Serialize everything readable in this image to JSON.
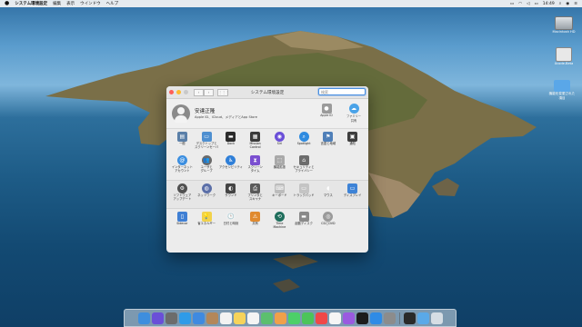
{
  "menubar": {
    "apple_icon": "apple-icon",
    "app_name": "システム環境設定",
    "menus": [
      "編集",
      "表示",
      "ウインドウ",
      "ヘルプ"
    ],
    "clock": "14:49",
    "status_icons": [
      "airplay-icon",
      "wifi-icon",
      "volume-icon",
      "battery-icon",
      "siri-icon",
      "search-icon",
      "menu-icon"
    ]
  },
  "desktop_icons": [
    {
      "label": "Macintosh HD",
      "icon": "hard-drive-icon"
    },
    {
      "label": "Xcode-Beta",
      "icon": "disk-image-icon"
    },
    {
      "label": "機能を変更された項目",
      "icon": "folder-icon"
    }
  ],
  "window": {
    "title": "システム環境設定",
    "search_placeholder": "検索",
    "nav_back": "‹",
    "nav_forward": "›",
    "grid_button": "⋮⋮⋮",
    "account": {
      "name": "安達正隆",
      "subtitle": "Apple ID、iCloud、メディアとApp Store",
      "items": [
        {
          "label": "Apple ID",
          "icon": "apple-id-icon",
          "color": "#9a9a9a"
        },
        {
          "label": "ファミリー\n共有",
          "icon": "family-sharing-icon",
          "color": "#4aa3e8"
        }
      ]
    },
    "sections": [
      [
        {
          "label": "一般",
          "icon": "general-icon",
          "color": "#5a7fa8",
          "glyph": "▤"
        },
        {
          "label": "デスクトップと\nスクリーンセーバ",
          "icon": "desktop-icon",
          "color": "#4e8fd0",
          "glyph": "▭"
        },
        {
          "label": "Dock",
          "icon": "dock-icon",
          "color": "#2b2b2b",
          "glyph": "▬"
        },
        {
          "label": "Mission\nControl",
          "icon": "mission-control-icon",
          "color": "#3a3a3a",
          "glyph": "▦"
        },
        {
          "label": "Siri",
          "icon": "siri-icon",
          "color": "#6a4fd8",
          "glyph": "◉",
          "round": true
        },
        {
          "label": "Spotlight",
          "icon": "spotlight-icon",
          "color": "#2f8be0",
          "glyph": "⌕",
          "round": true
        },
        {
          "label": "言語と地域",
          "icon": "language-icon",
          "color": "#4f7fb8",
          "glyph": "⚑"
        },
        {
          "label": "通知",
          "icon": "notifications-icon",
          "color": "#3d3d3d",
          "glyph": "▣"
        },
        {
          "label": "インターネット\nアカウント",
          "icon": "internet-accounts-icon",
          "color": "#3b8ee0",
          "glyph": "@",
          "round": true
        },
        {
          "label": "ユーザと\nグループ",
          "icon": "users-groups-icon",
          "color": "#6a6a6a",
          "glyph": "👥",
          "round": true
        },
        {
          "label": "アクセシビリティ",
          "icon": "accessibility-icon",
          "color": "#2f7fd8",
          "glyph": "♿",
          "round": true
        },
        {
          "label": "スクリーン\nタイム",
          "icon": "screen-time-icon",
          "color": "#7a4fd0",
          "glyph": "⧗"
        },
        {
          "label": "機能拡張",
          "icon": "extensions-icon",
          "color": "#a9a9a9",
          "glyph": "⬚"
        },
        {
          "label": "セキュリティと\nプライバシー",
          "icon": "security-icon",
          "color": "#6c6c6c",
          "glyph": "⌂"
        }
      ],
      [
        {
          "label": "ソフトウェア\nアップデート",
          "icon": "software-update-icon",
          "color": "#505050",
          "glyph": "⚙",
          "round": true
        },
        {
          "label": "ネットワーク",
          "icon": "network-icon",
          "color": "#5b6fa8",
          "glyph": "◍",
          "round": true
        },
        {
          "label": "サウンド",
          "icon": "sound-icon",
          "color": "#444444",
          "glyph": "◐"
        },
        {
          "label": "プリンタと\nスキャナ",
          "icon": "printers-icon",
          "color": "#5a5a5a",
          "glyph": "⎙"
        },
        {
          "label": "キーボード",
          "icon": "keyboard-icon",
          "color": "#bcbcbc",
          "glyph": "⌨"
        },
        {
          "label": "トラックパッド",
          "icon": "trackpad-icon",
          "color": "#c4c4c4",
          "glyph": "▭"
        },
        {
          "label": "マウス",
          "icon": "mouse-icon",
          "color": "#e6e6e6",
          "glyph": "◖"
        },
        {
          "label": "ディスプレイ",
          "icon": "displays-icon",
          "color": "#3e83d6",
          "glyph": "▭"
        }
      ],
      [
        {
          "label": "Sidecar",
          "icon": "sidecar-icon",
          "color": "#3f7fd4",
          "glyph": "▯"
        },
        {
          "label": "省エネルギー",
          "icon": "energy-saver-icon",
          "color": "#f2d24a",
          "glyph": "💡"
        },
        {
          "label": "日付と時刻",
          "icon": "date-time-icon",
          "color": "#eeeeee",
          "glyph": "🕒",
          "round": true
        },
        {
          "label": "共有",
          "icon": "sharing-icon",
          "color": "#e08a2f",
          "glyph": "⚠"
        },
        {
          "label": "Time\nMachine",
          "icon": "time-machine-icon",
          "color": "#1f6e5c",
          "glyph": "⟲",
          "round": true
        },
        {
          "label": "起動ディスク",
          "icon": "startup-disk-icon",
          "color": "#8a8a8a",
          "glyph": "▬"
        },
        {
          "label": "CDとDVD",
          "icon": "cd-dvd-icon",
          "color": "#9a9a9a",
          "glyph": "◎",
          "round": true
        }
      ]
    ]
  },
  "dock": [
    {
      "name": "finder-icon",
      "color": "#3e8ede"
    },
    {
      "name": "siri-icon",
      "color": "#6a4fd8"
    },
    {
      "name": "launchpad-icon",
      "color": "#6c6c6c"
    },
    {
      "name": "safari-icon",
      "color": "#2f9be8"
    },
    {
      "name": "mail-icon",
      "color": "#3f8ae0"
    },
    {
      "name": "contacts-icon",
      "color": "#b3875a"
    },
    {
      "name": "calendar-icon",
      "color": "#f2f2f2"
    },
    {
      "name": "notes-icon",
      "color": "#f6d35a"
    },
    {
      "name": "reminders-icon",
      "color": "#f4f4f4"
    },
    {
      "name": "maps-icon",
      "color": "#5cbf6e"
    },
    {
      "name": "photos-icon",
      "color": "#f0a04a"
    },
    {
      "name": "messages-icon",
      "color": "#4cd068"
    },
    {
      "name": "facetime-icon",
      "color": "#4cc45a"
    },
    {
      "name": "news-icon",
      "color": "#f04848"
    },
    {
      "name": "music-icon",
      "color": "#f5f5f5"
    },
    {
      "name": "podcasts-icon",
      "color": "#9a5ae0"
    },
    {
      "name": "tv-icon",
      "color": "#1c1c1c"
    },
    {
      "name": "app-store-icon",
      "color": "#2f8be6"
    },
    {
      "name": "system-preferences-icon",
      "color": "#8c8c8c"
    },
    {
      "name": "terminal-icon",
      "color": "#2a2a2a"
    },
    {
      "name": "downloads-icon",
      "color": "#5aa9e8"
    },
    {
      "name": "trash-icon",
      "color": "#d6dde4"
    }
  ]
}
